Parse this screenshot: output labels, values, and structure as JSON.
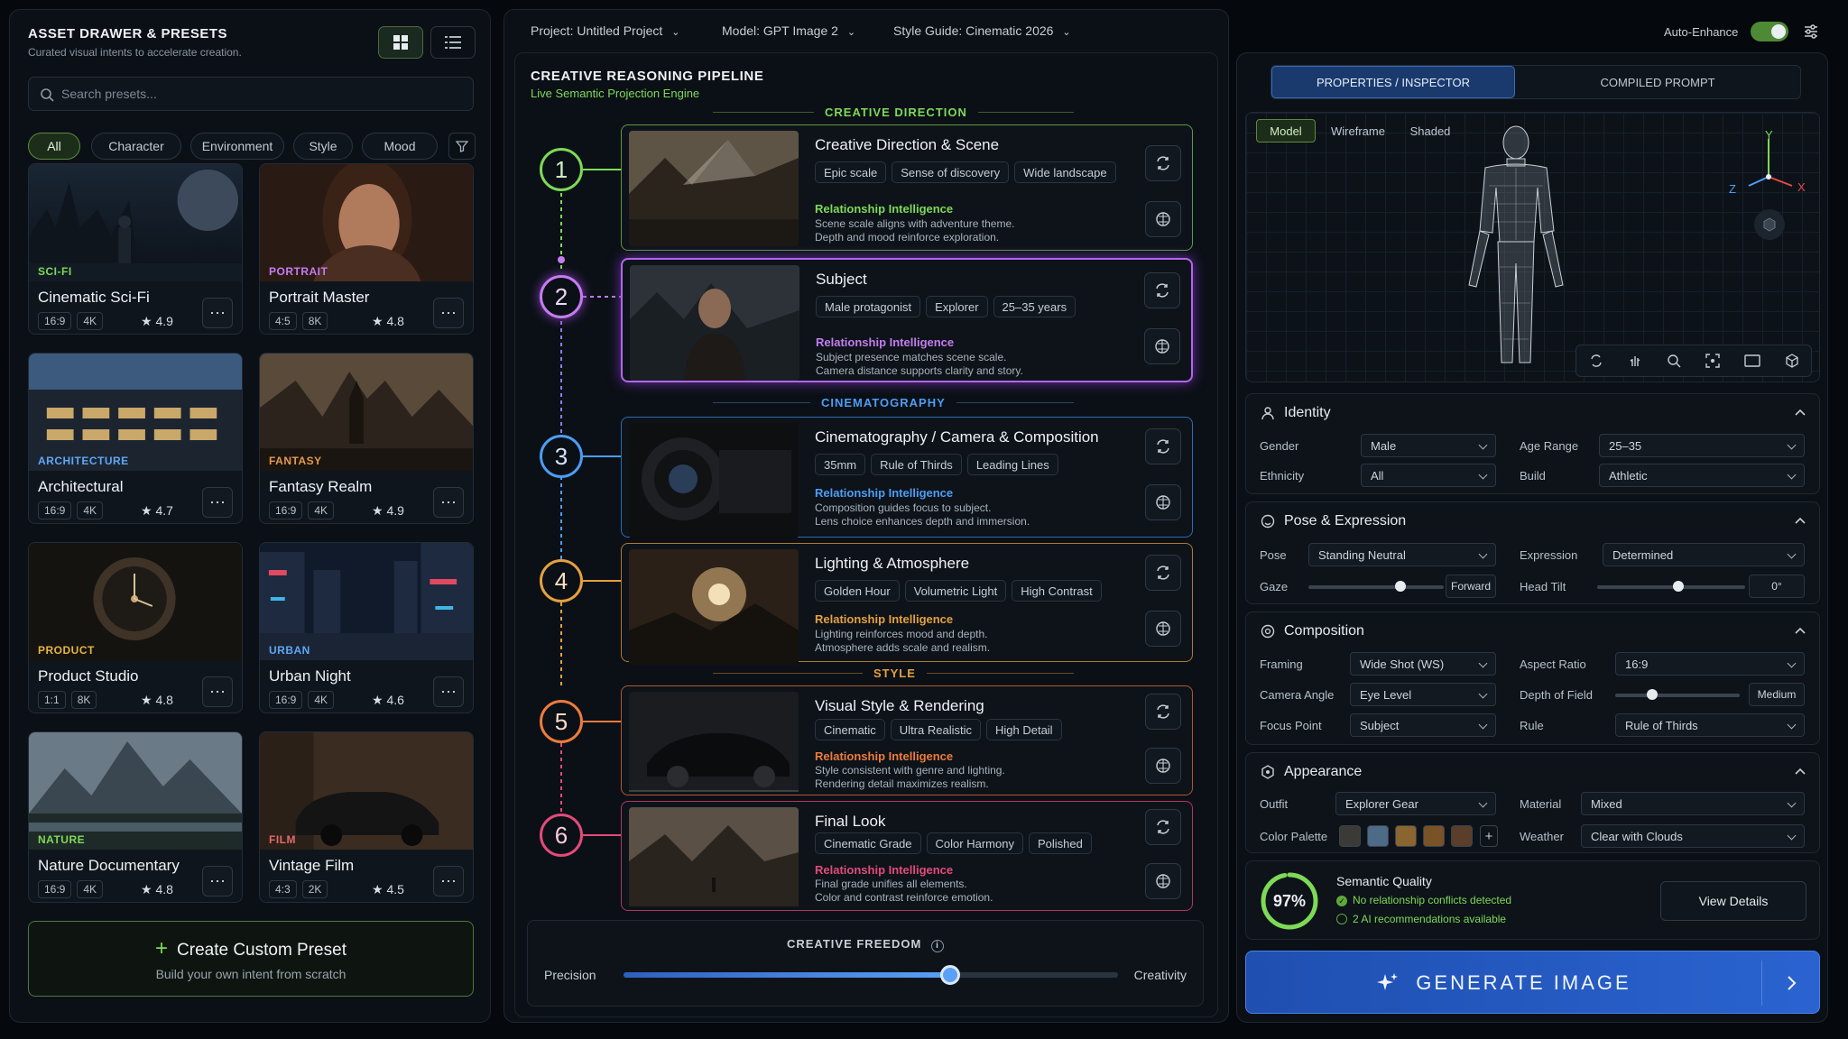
{
  "drawer": {
    "title": "ASSET DRAWER & PRESETS",
    "subtitle": "Curated visual intents to accelerate creation.",
    "search_placeholder": "Search presets...",
    "filters": [
      "All",
      "Character",
      "Environment",
      "Style",
      "Mood"
    ],
    "cards": [
      {
        "cat": "SCI-FI",
        "name": "Cinematic Sci-Fi",
        "tags": [
          "16:9",
          "4K"
        ],
        "rating": "4.9",
        "cat_color": "#7ed957"
      },
      {
        "cat": "PORTRAIT",
        "name": "Portrait Master",
        "tags": [
          "4:5",
          "8K"
        ],
        "rating": "4.8",
        "cat_color": "#c57cf0"
      },
      {
        "cat": "ARCHITECTURE",
        "name": "Architectural",
        "tags": [
          "16:9",
          "4K"
        ],
        "rating": "4.7",
        "cat_color": "#5fa8f5"
      },
      {
        "cat": "FANTASY",
        "name": "Fantasy Realm",
        "tags": [
          "16:9",
          "4K"
        ],
        "rating": "4.9",
        "cat_color": "#e59a4a"
      },
      {
        "cat": "PRODUCT",
        "name": "Product Studio",
        "tags": [
          "1:1",
          "8K"
        ],
        "rating": "4.8",
        "cat_color": "#e5b43f"
      },
      {
        "cat": "URBAN",
        "name": "Urban Night",
        "tags": [
          "16:9",
          "4K"
        ],
        "rating": "4.6",
        "cat_color": "#5fa8f5"
      },
      {
        "cat": "NATURE",
        "name": "Nature Documentary",
        "tags": [
          "16:9",
          "4K"
        ],
        "rating": "4.8",
        "cat_color": "#7ed957"
      },
      {
        "cat": "FILM",
        "name": "Vintage Film",
        "tags": [
          "4:3",
          "2K"
        ],
        "rating": "4.5",
        "cat_color": "#e56a6a"
      }
    ],
    "create_title": "Create Custom Preset",
    "create_sub": "Build your own intent from scratch"
  },
  "topbar": {
    "project_label": "Project:",
    "project": "Untitled Project",
    "model_label": "Model:",
    "model": "GPT Image 2",
    "style_label": "Style Guide:",
    "style": "Cinematic 2026",
    "auto_enhance": "Auto-Enhance"
  },
  "pipeline": {
    "title": "CREATIVE REASONING PIPELINE",
    "subtitle": "Live Semantic Projection Engine",
    "sections": [
      "CREATIVE DIRECTION",
      "CINEMATOGRAPHY",
      "STYLE"
    ],
    "steps": [
      {
        "n": "1",
        "title": "Creative Direction & Scene",
        "chips": [
          "Epic scale",
          "Sense of discovery",
          "Wide landscape"
        ],
        "ri": "Relationship Intelligence",
        "d1": "Scene scale aligns with adventure theme.",
        "d2": "Depth and mood reinforce exploration.",
        "color": "#7ed957"
      },
      {
        "n": "2",
        "title": "Subject",
        "chips": [
          "Male protagonist",
          "Explorer",
          "25–35 years"
        ],
        "ri": "Relationship Intelligence",
        "d1": "Subject presence matches scene scale.",
        "d2": "Camera distance supports clarity and story.",
        "color": "#c57cf0"
      },
      {
        "n": "3",
        "title": "Cinematography / Camera & Composition",
        "chips": [
          "35mm",
          "Rule of Thirds",
          "Leading Lines"
        ],
        "ri": "Relationship Intelligence",
        "d1": "Composition guides focus to subject.",
        "d2": "Lens choice enhances depth and immersion.",
        "color": "#4d9df5"
      },
      {
        "n": "4",
        "title": "Lighting & Atmosphere",
        "chips": [
          "Golden Hour",
          "Volumetric Light",
          "High Contrast"
        ],
        "ri": "Relationship Intelligence",
        "d1": "Lighting reinforces mood and depth.",
        "d2": "Atmosphere adds scale and realism.",
        "color": "#e5a03f"
      },
      {
        "n": "5",
        "title": "Visual Style & Rendering",
        "chips": [
          "Cinematic",
          "Ultra Realistic",
          "High Detail"
        ],
        "ri": "Relationship Intelligence",
        "d1": "Style consistent with genre and lighting.",
        "d2": "Rendering detail maximizes realism.",
        "color": "#ee7b3c"
      },
      {
        "n": "6",
        "title": "Final Look",
        "chips": [
          "Cinematic Grade",
          "Color Harmony",
          "Polished"
        ],
        "ri": "Relationship Intelligence",
        "d1": "Final grade unifies all elements.",
        "d2": "Color and contrast reinforce emotion.",
        "color": "#e24b7a"
      }
    ],
    "freedom_label": "CREATIVE FREEDOM",
    "precision": "Precision",
    "creativity": "Creativity",
    "freedom_value": 0.66
  },
  "inspector": {
    "tabs": [
      "PROPERTIES / INSPECTOR",
      "COMPILED PROMPT"
    ],
    "view_modes": [
      "Model",
      "Wireframe",
      "Shaded"
    ],
    "axes": [
      "Y",
      "Z",
      "X"
    ],
    "identity": {
      "title": "Identity",
      "gender_l": "Gender",
      "gender": "Male",
      "age_l": "Age Range",
      "age": "25–35",
      "eth_l": "Ethnicity",
      "eth": "All",
      "build_l": "Build",
      "build": "Athletic"
    },
    "pose": {
      "title": "Pose & Expression",
      "pose_l": "Pose",
      "pose": "Standing Neutral",
      "expr_l": "Expression",
      "expr": "Determined",
      "gaze_l": "Gaze",
      "gaze": "Forward",
      "gaze_value": 0.68,
      "tilt_l": "Head Tilt",
      "tilt": "0°",
      "tilt_value": 0.55
    },
    "composition": {
      "title": "Composition",
      "framing_l": "Framing",
      "framing": "Wide Shot (WS)",
      "aspect_l": "Aspect Ratio",
      "aspect": "16:9",
      "angle_l": "Camera Angle",
      "angle": "Eye Level",
      "dof_l": "Depth of Field",
      "dof": "Medium",
      "dof_value": 0.3,
      "focus_l": "Focus Point",
      "focus": "Subject",
      "rule_l": "Rule",
      "rule": "Rule of Thirds"
    },
    "appearance": {
      "title": "Appearance",
      "outfit_l": "Outfit",
      "outfit": "Explorer Gear",
      "material_l": "Material",
      "material": "Mixed",
      "palette_l": "Color Palette",
      "palette": [
        "#3b3a36",
        "#4d6a86",
        "#8a6530",
        "#7a5228",
        "#5a3e2a"
      ],
      "weather_l": "Weather",
      "weather": "Clear with Clouds"
    },
    "quality": {
      "pct": "97%",
      "value": 0.97,
      "title": "Semantic Quality",
      "l1": "No relationship conflicts detected",
      "l2": "2 AI recommendations available",
      "btn": "View Details"
    },
    "generate": "GENERATE IMAGE"
  }
}
